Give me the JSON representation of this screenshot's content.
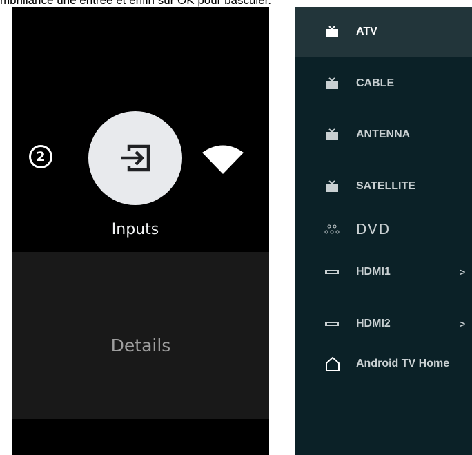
{
  "caption": "mbrillance une entrée et enfin sur OK pour basculer.",
  "left": {
    "badge": "2",
    "inputs_label": "Inputs",
    "details_label": "Details"
  },
  "inputs_list": {
    "items": [
      {
        "label": "ATV",
        "icon": "tv-icon",
        "selected": true
      },
      {
        "label": "CABLE",
        "icon": "tv-icon"
      },
      {
        "label": "ANTENNA",
        "icon": "tv-icon"
      },
      {
        "label": "SATELLITE",
        "icon": "tv-icon"
      },
      {
        "label": "DVD",
        "icon": "dvd-dots-icon"
      },
      {
        "label": "HDMI1",
        "icon": "hdmi-icon",
        "chevron": ">"
      },
      {
        "label": "HDMI2",
        "icon": "hdmi-icon",
        "chevron": ">"
      },
      {
        "label": "Android TV Home",
        "icon": "home-icon"
      }
    ]
  },
  "colors": {
    "left_bg": "#000000",
    "details_bg": "#191919",
    "right_bg": "#0b2127",
    "selected_bg": "#22353a",
    "circle": "#e8eaed"
  }
}
